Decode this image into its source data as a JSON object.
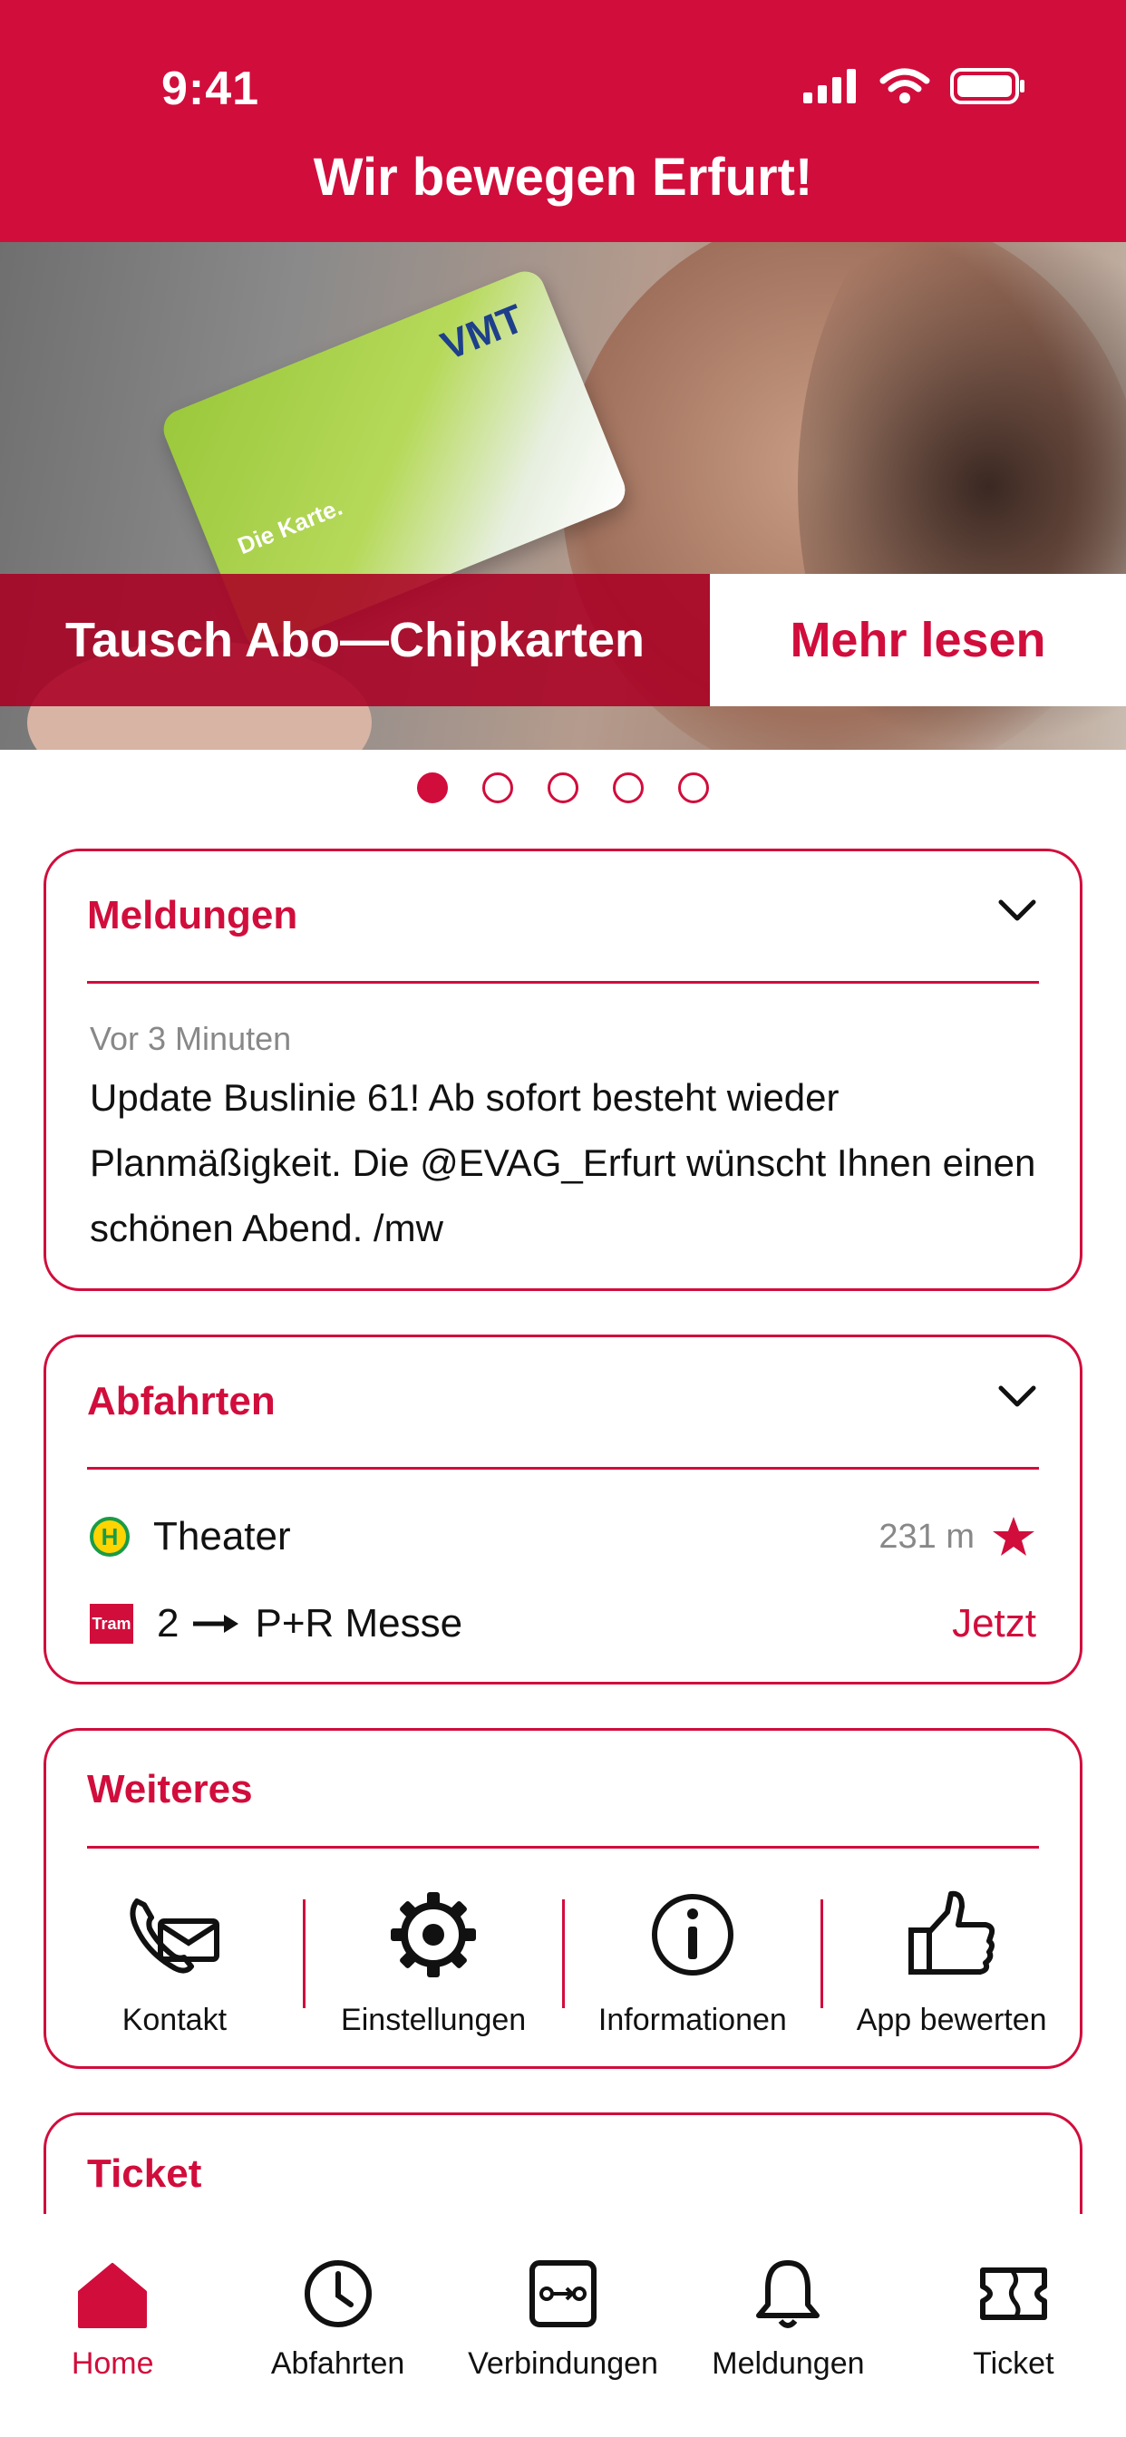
{
  "status_bar": {
    "time": "9:41"
  },
  "header": {
    "title": "Wir bewegen Erfurt!"
  },
  "hero": {
    "card_logo": "VMT",
    "card_text": "Die Karte.",
    "banner_title": "Tausch Abo—Chipkarten",
    "banner_action": "Mehr lesen",
    "pager_count": 5,
    "pager_active": 1
  },
  "messages_card": {
    "title": "Meldungen",
    "time": "Vor 3 Minuten",
    "text": "Update Buslinie 61! Ab sofort besteht wieder Planmäßigkeit. Die @EVAG_Erfurt wünscht Ihnen einen schönen Abend. /mw"
  },
  "departures_card": {
    "title": "Abfahrten",
    "stop_icon": "H",
    "stop_name": "Theater",
    "distance": "231 m",
    "tram_badge": "Tram",
    "line": "2",
    "destination": "P+R Messe",
    "time": "Jetzt"
  },
  "more_card": {
    "title": "Weiteres",
    "items": [
      {
        "label": "Kontakt",
        "icon": "contact-icon"
      },
      {
        "label": "Einstellungen",
        "icon": "gear-icon"
      },
      {
        "label": "Informationen",
        "icon": "info-icon"
      },
      {
        "label": "App bewerten",
        "icon": "thumbs-up-icon"
      }
    ]
  },
  "ticket_card": {
    "title": "Ticket"
  },
  "bottom_nav": {
    "items": [
      {
        "label": "Home",
        "icon": "home-icon",
        "active": true
      },
      {
        "label": "Abfahrten",
        "icon": "clock-icon",
        "active": false
      },
      {
        "label": "Verbindungen",
        "icon": "route-icon",
        "active": false
      },
      {
        "label": "Meldungen",
        "icon": "bell-icon",
        "active": false
      },
      {
        "label": "Ticket",
        "icon": "ticket-icon",
        "active": false
      }
    ]
  },
  "colors": {
    "brand": "#d10d3c",
    "text": "#111111",
    "muted": "#888888"
  }
}
